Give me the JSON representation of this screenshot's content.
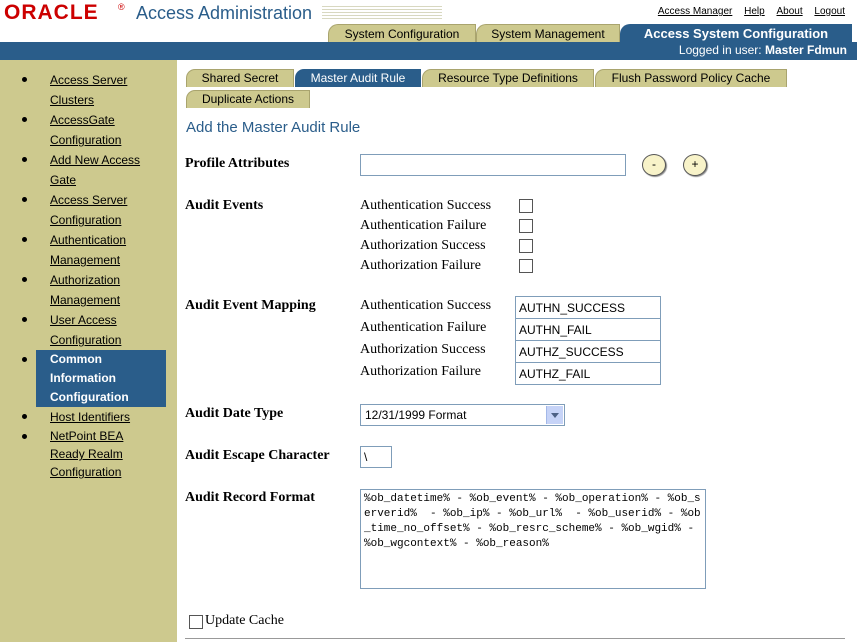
{
  "app": {
    "logo_text": "ORACLE",
    "logo_mark": "®",
    "title": "Access Administration"
  },
  "top_links": [
    "Access Manager",
    "Help",
    "About",
    "Logout"
  ],
  "main_tabs": [
    {
      "label": "System Configuration"
    },
    {
      "label": "System Management"
    },
    {
      "label": "Access System Configuration"
    }
  ],
  "logged_in": {
    "prefix": "Logged in user:",
    "user": "Master Fdmun"
  },
  "sidebar": {
    "items": [
      {
        "lines": [
          "Access Server",
          "Clusters"
        ]
      },
      {
        "lines": [
          "AccessGate",
          "Configuration"
        ]
      },
      {
        "lines": [
          "Add New Access",
          "Gate"
        ]
      },
      {
        "lines": [
          "Access Server",
          "Configuration"
        ]
      },
      {
        "lines": [
          "Authentication",
          "Management"
        ]
      },
      {
        "lines": [
          "Authorization",
          "Management"
        ]
      },
      {
        "lines": [
          "User Access",
          "Configuration"
        ]
      },
      {
        "lines": [
          "Common",
          "Information",
          "Configuration"
        ]
      },
      {
        "lines": [
          "Host Identifiers"
        ]
      },
      {
        "lines": [
          "NetPoint BEA",
          "Ready Realm",
          "Configuration"
        ]
      }
    ]
  },
  "sub_tabs": [
    "Shared Secret",
    "Master Audit Rule",
    "Resource Type Definitions",
    "Flush Password Policy Cache",
    "Duplicate Actions"
  ],
  "form": {
    "heading": "Add the Master Audit Rule",
    "profile_attributes_label": "Profile Attributes",
    "profile_attributes_value": "",
    "minus_label": "-",
    "plus_label": "+",
    "audit_events_label": "Audit Events",
    "audit_events": [
      "Authentication Success",
      "Authentication Failure",
      "Authorization Success",
      "Authorization Failure"
    ],
    "audit_event_mapping_label": "Audit Event Mapping",
    "mapping": [
      {
        "label": "Authentication Success",
        "value": "AUTHN_SUCCESS"
      },
      {
        "label": "Authentication Failure",
        "value": "AUTHN_FAIL"
      },
      {
        "label": "Authorization Success",
        "value": "AUTHZ_SUCCESS"
      },
      {
        "label": "Authorization Failure",
        "value": "AUTHZ_FAIL"
      }
    ],
    "audit_date_type_label": "Audit Date Type",
    "audit_date_type_value": "12/31/1999 Format",
    "audit_escape_label": "Audit Escape Character",
    "audit_escape_value": "\\",
    "audit_record_label": "Audit Record Format",
    "audit_record_value": "%ob_datetime% - %ob_event% - %ob_operation% - %ob_serverid%  - %ob_ip% - %ob_url%  - %ob_userid% - %ob_time_no_offset% - %ob_resrc_scheme% - %ob_wgid% - %ob_wgcontext% - %ob_reason%",
    "update_cache_label": "Update Cache"
  }
}
